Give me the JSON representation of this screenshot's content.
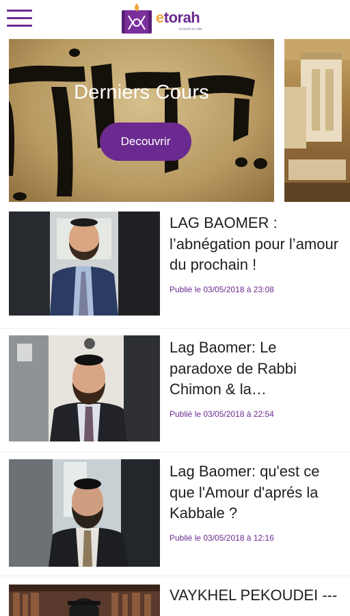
{
  "header": {
    "menu_icon": "hamburger-menu-icon",
    "logo_icon": "torah-scroll-logo-icon",
    "brand_e": "e",
    "brand_rest": "torah",
    "tagline": "la torah en ville"
  },
  "carousel": {
    "title": "Derniers Cours",
    "button_label": "Decouvrir"
  },
  "articles": [
    {
      "title": "LAG BAOMER : l’abnégation pour l’amour du prochain !",
      "date": "Publié le 03/05/2018 à 23:08"
    },
    {
      "title": "Lag Baomer: Le paradoxe de Rabbi Chimon & la…",
      "date": "Publié le 03/05/2018 à 22:54"
    },
    {
      "title": "Lag Baomer: qu'est ce que l'Amour d'aprés la Kabbale ?",
      "date": "Publié le 03/05/2018 à 12:16"
    },
    {
      "title": "VAYKHEL PEKOUDEI ----",
      "date": ""
    }
  ],
  "colors": {
    "brand_purple": "#6b2a8f",
    "brand_orange": "#f0a33a"
  }
}
